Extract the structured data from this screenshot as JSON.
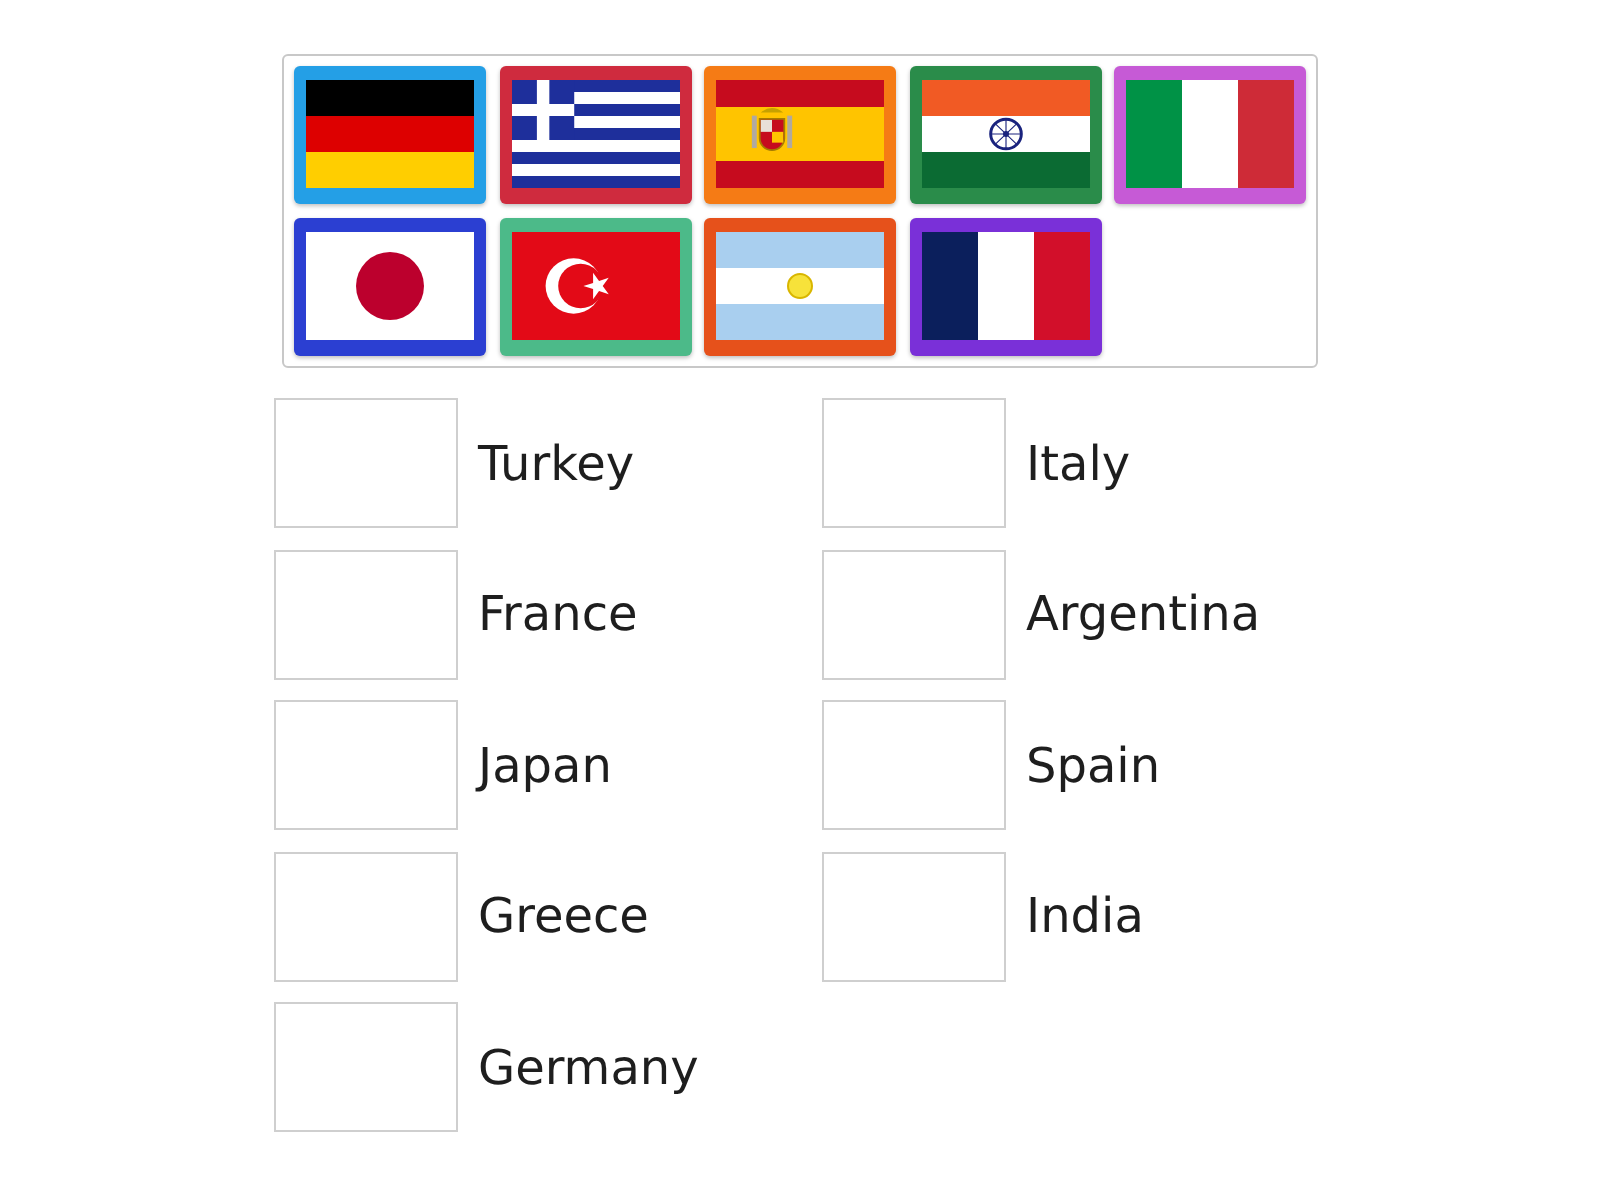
{
  "flags": [
    {
      "kind": "germany",
      "color": "#249fe6"
    },
    {
      "kind": "greece",
      "color": "#cf2b3e"
    },
    {
      "kind": "spain",
      "color": "#f57b15"
    },
    {
      "kind": "india",
      "color": "#2a8c4a"
    },
    {
      "kind": "italy",
      "color": "#c65ad6"
    },
    {
      "kind": "japan",
      "color": "#2b3fd2"
    },
    {
      "kind": "turkey",
      "color": "#4cba89"
    },
    {
      "kind": "argentina",
      "color": "#e6511b"
    },
    {
      "kind": "france",
      "color": "#7a30d8"
    }
  ],
  "answers": [
    {
      "label": "Turkey"
    },
    {
      "label": "Italy"
    },
    {
      "label": "France"
    },
    {
      "label": "Argentina"
    },
    {
      "label": "Japan"
    },
    {
      "label": "Spain"
    },
    {
      "label": "Greece"
    },
    {
      "label": "India"
    },
    {
      "label": "Germany"
    }
  ]
}
